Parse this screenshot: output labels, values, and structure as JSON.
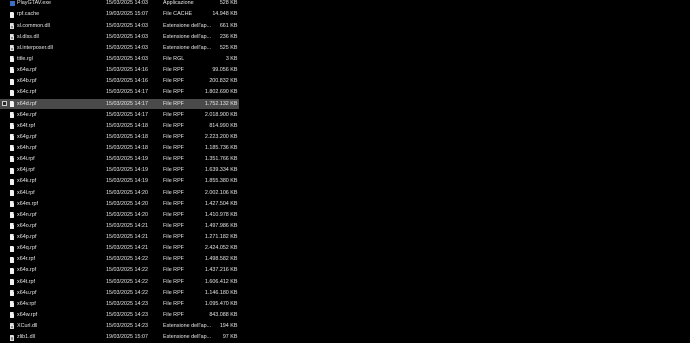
{
  "files": [
    {
      "name": "PlayGTAV.exe",
      "date": "15/03/2025 14:03",
      "type": "Applicazione",
      "size": "528 KB",
      "icon": "exe-icon"
    },
    {
      "name": "rpf.cache",
      "date": "19/03/2025 15:07",
      "type": "File CACHE",
      "size": "14.948 KB",
      "icon": "file-icon"
    },
    {
      "name": "sl.common.dll",
      "date": "15/03/2025 14:03",
      "type": "Estensione dell'ap...",
      "size": "661 KB",
      "icon": "dll-icon"
    },
    {
      "name": "sl.dlss.dll",
      "date": "15/03/2025 14:03",
      "type": "Estensione dell'ap...",
      "size": "236 KB",
      "icon": "dll-icon"
    },
    {
      "name": "sl.interposer.dll",
      "date": "15/03/2025 14:03",
      "type": "Estensione dell'ap...",
      "size": "525 KB",
      "icon": "dll-icon"
    },
    {
      "name": "title.rgl",
      "date": "15/03/2025 14:03",
      "type": "File RGL",
      "size": "3 KB",
      "icon": "file-icon"
    },
    {
      "name": "x64a.rpf",
      "date": "15/03/2025 14:16",
      "type": "File RPF",
      "size": "99.056 KB",
      "icon": "file-icon"
    },
    {
      "name": "x64b.rpf",
      "date": "15/03/2025 14:16",
      "type": "File RPF",
      "size": "200.832 KB",
      "icon": "file-icon"
    },
    {
      "name": "x64c.rpf",
      "date": "15/03/2025 14:17",
      "type": "File RPF",
      "size": "1.802.690 KB",
      "icon": "file-icon"
    },
    {
      "name": "x64d.rpf",
      "date": "15/03/2025 14:17",
      "type": "File RPF",
      "size": "1.752.132 KB",
      "icon": "file-icon",
      "selected": true
    },
    {
      "name": "x64e.rpf",
      "date": "15/03/2025 14:17",
      "type": "File RPF",
      "size": "2.018.900 KB",
      "icon": "file-icon"
    },
    {
      "name": "x64f.rpf",
      "date": "15/03/2025 14:18",
      "type": "File RPF",
      "size": "814.990 KB",
      "icon": "file-icon"
    },
    {
      "name": "x64g.rpf",
      "date": "15/03/2025 14:18",
      "type": "File RPF",
      "size": "2.223.200 KB",
      "icon": "file-icon"
    },
    {
      "name": "x64h.rpf",
      "date": "15/03/2025 14:18",
      "type": "File RPF",
      "size": "1.185.736 KB",
      "icon": "file-icon"
    },
    {
      "name": "x64i.rpf",
      "date": "15/03/2025 14:19",
      "type": "File RPF",
      "size": "1.351.766 KB",
      "icon": "file-icon"
    },
    {
      "name": "x64j.rpf",
      "date": "15/03/2025 14:19",
      "type": "File RPF",
      "size": "1.639.334 KB",
      "icon": "file-icon"
    },
    {
      "name": "x64k.rpf",
      "date": "15/03/2025 14:19",
      "type": "File RPF",
      "size": "1.855.380 KB",
      "icon": "file-icon"
    },
    {
      "name": "x64l.rpf",
      "date": "15/03/2025 14:20",
      "type": "File RPF",
      "size": "2.002.106 KB",
      "icon": "file-icon"
    },
    {
      "name": "x64m.rpf",
      "date": "15/03/2025 14:20",
      "type": "File RPF",
      "size": "1.427.504 KB",
      "icon": "file-icon"
    },
    {
      "name": "x64n.rpf",
      "date": "15/03/2025 14:20",
      "type": "File RPF",
      "size": "1.410.978 KB",
      "icon": "file-icon"
    },
    {
      "name": "x64o.rpf",
      "date": "15/03/2025 14:21",
      "type": "File RPF",
      "size": "1.497.986 KB",
      "icon": "file-icon"
    },
    {
      "name": "x64p.rpf",
      "date": "15/03/2025 14:21",
      "type": "File RPF",
      "size": "1.271.182 KB",
      "icon": "file-icon"
    },
    {
      "name": "x64q.rpf",
      "date": "15/03/2025 14:21",
      "type": "File RPF",
      "size": "2.424.052 KB",
      "icon": "file-icon"
    },
    {
      "name": "x64r.rpf",
      "date": "15/03/2025 14:22",
      "type": "File RPF",
      "size": "1.498.582 KB",
      "icon": "file-icon"
    },
    {
      "name": "x64s.rpf",
      "date": "15/03/2025 14:22",
      "type": "File RPF",
      "size": "1.437.216 KB",
      "icon": "file-icon"
    },
    {
      "name": "x64t.rpf",
      "date": "15/03/2025 14:22",
      "type": "File RPF",
      "size": "1.606.412 KB",
      "icon": "file-icon"
    },
    {
      "name": "x64u.rpf",
      "date": "15/03/2025 14:22",
      "type": "File RPF",
      "size": "1.146.180 KB",
      "icon": "file-icon"
    },
    {
      "name": "x64v.rpf",
      "date": "15/03/2025 14:23",
      "type": "File RPF",
      "size": "1.095.470 KB",
      "icon": "file-icon"
    },
    {
      "name": "x64w.rpf",
      "date": "15/03/2025 14:23",
      "type": "File RPF",
      "size": "843.088 KB",
      "icon": "file-icon"
    },
    {
      "name": "XCurl.dll",
      "date": "15/03/2025 14:23",
      "type": "Estensione dell'ap...",
      "size": "194 KB",
      "icon": "dll-icon"
    },
    {
      "name": "zlib1.dll",
      "date": "19/03/2025 15:07",
      "type": "Estensione dell'ap...",
      "size": "97 KB",
      "icon": "dll-icon"
    }
  ]
}
